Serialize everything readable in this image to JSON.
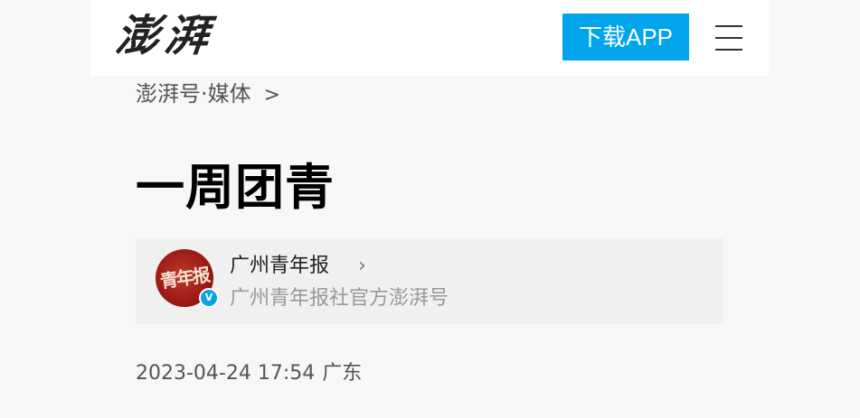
{
  "header": {
    "logo_text": "澎湃",
    "download_label": "下载APP",
    "menu_icon": "hamburger-menu-icon"
  },
  "breadcrumb": {
    "label": "澎湃号·媒体",
    "separator": ">"
  },
  "article": {
    "title": "一周团青",
    "date": "2023-04-24 17:54",
    "location": "广东"
  },
  "author": {
    "name": "广州青年报",
    "chevron": "›",
    "description": "广州青年报社官方澎湃号",
    "avatar_text": "青年报",
    "verified_icon": "verified-badge-icon",
    "verified_mark": "V"
  },
  "colors": {
    "accent": "#00a5eb",
    "page_bg": "#f6f7f6",
    "header_bg": "#ffffff",
    "card_bg": "#f0f0f0"
  }
}
